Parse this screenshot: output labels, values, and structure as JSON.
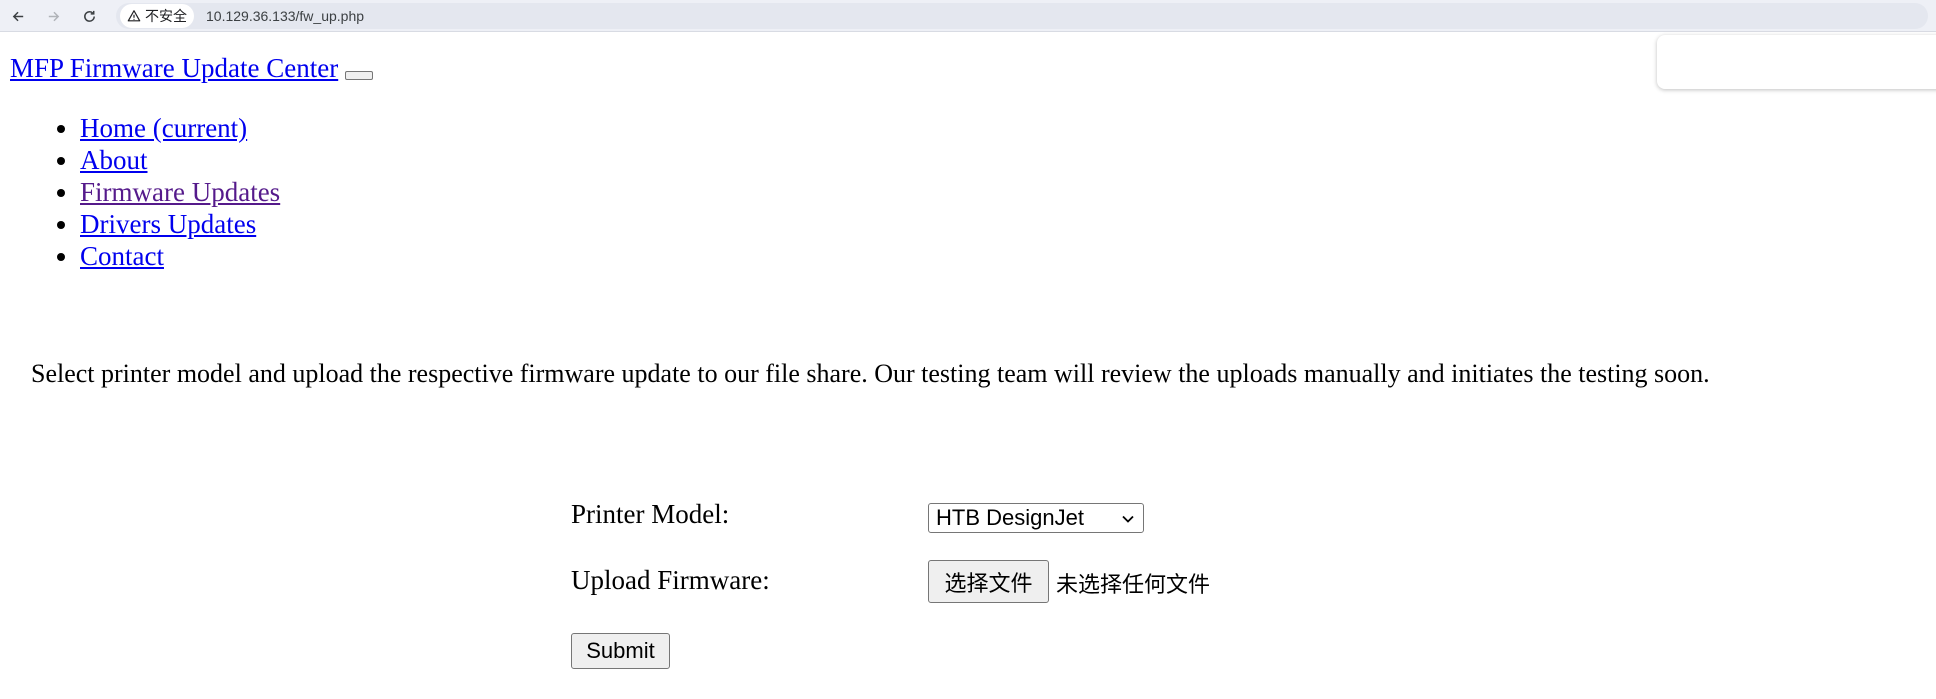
{
  "browser": {
    "back_icon": "arrow-left-icon",
    "forward_icon": "arrow-right-icon",
    "reload_icon": "reload-icon",
    "security_icon": "warning-triangle-icon",
    "security_label": "不安全",
    "url": "10.129.36.133/fw_up.php"
  },
  "navbar": {
    "brand": "MFP Firmware Update Center",
    "items": [
      {
        "label": "Home (current)"
      },
      {
        "label": "About"
      },
      {
        "label": "Firmware Updates"
      },
      {
        "label": "Drivers Updates"
      },
      {
        "label": "Contact"
      }
    ]
  },
  "main": {
    "intro": "Select printer model and upload the respective firmware update to our file share. Our testing team will review the uploads manually and initiates the testing soon."
  },
  "form": {
    "model_label": "Printer Model:",
    "model_selected": "HTB DesignJet",
    "upload_label": "Upload Firmware:",
    "file_button_label": "选择文件",
    "file_status": "未选择任何文件",
    "submit_label": "Submit"
  },
  "colors": {
    "link": "#0000ee",
    "visited_link": "#551a8b",
    "browser_bar": "#eef0f6"
  }
}
